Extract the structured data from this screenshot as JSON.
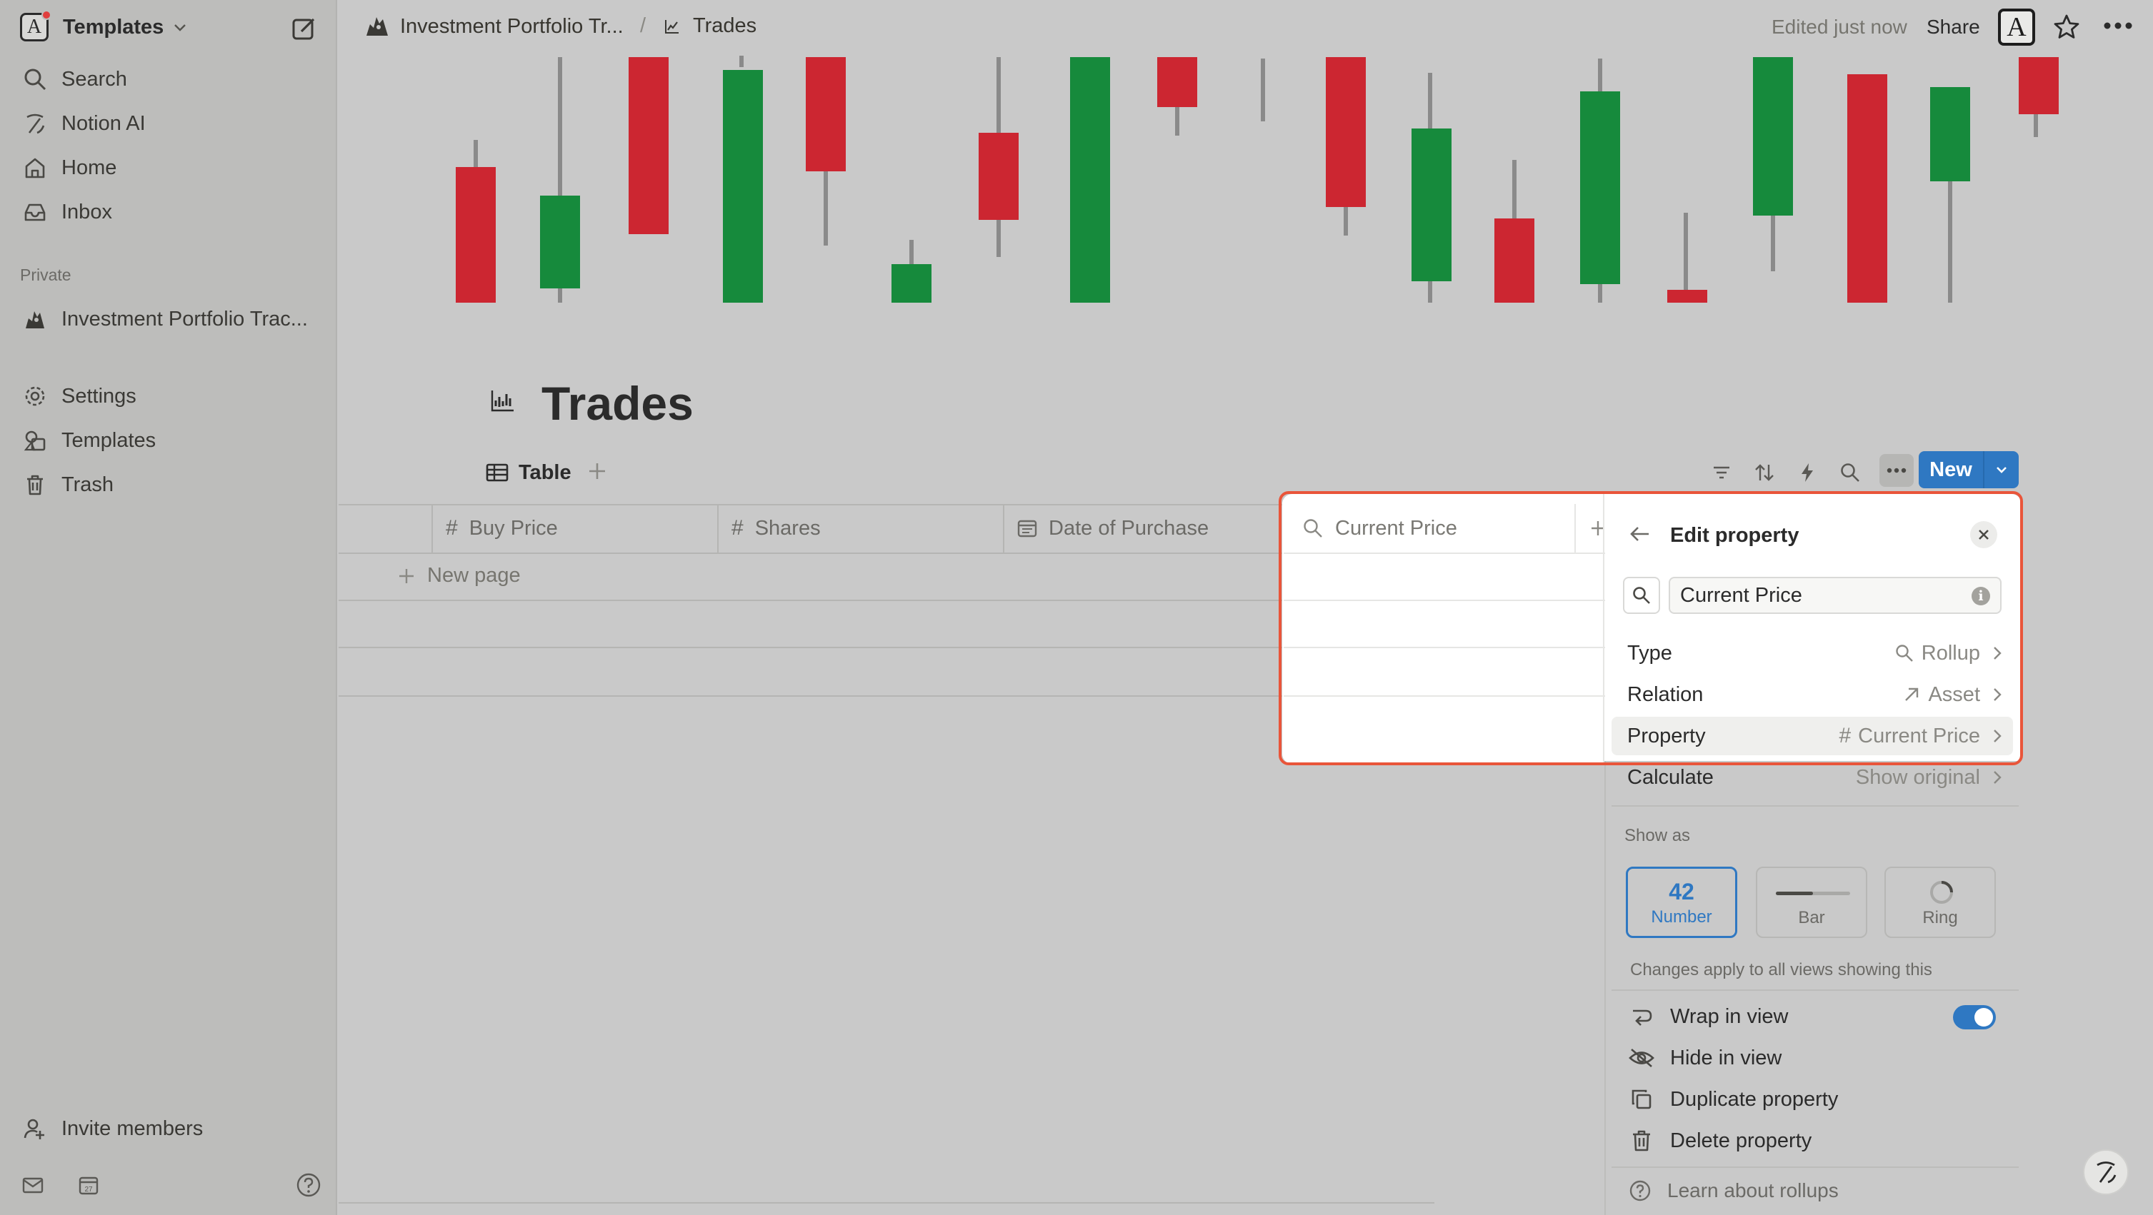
{
  "sidebar": {
    "workspace_name": "Templates",
    "items": [
      {
        "label": "Search",
        "icon": "search-icon"
      },
      {
        "label": "Notion AI",
        "icon": "notion-ai-icon"
      },
      {
        "label": "Home",
        "icon": "home-icon"
      },
      {
        "label": "Inbox",
        "icon": "inbox-icon"
      }
    ],
    "private_label": "Private",
    "private_pages": [
      {
        "label": "Investment Portfolio Trac...",
        "icon": "portfolio-icon"
      }
    ],
    "bottom_items": [
      {
        "label": "Settings",
        "icon": "gear-icon"
      },
      {
        "label": "Templates",
        "icon": "templates-icon"
      },
      {
        "label": "Trash",
        "icon": "trash-icon"
      }
    ],
    "invite_label": "Invite members"
  },
  "topbar": {
    "breadcrumb": [
      "Investment Portfolio Tr...",
      "Trades"
    ],
    "separator": "/",
    "edited": "Edited just now",
    "share": "Share",
    "avatar_letter": "A"
  },
  "page": {
    "title": "Trades"
  },
  "view": {
    "tab_label": "Table",
    "new_button": "New"
  },
  "table": {
    "columns": [
      {
        "label": "Buy Price",
        "type_icon": "#"
      },
      {
        "label": "Shares",
        "type_icon": "#"
      },
      {
        "label": "Date of Purchase",
        "type_icon": "calendar-icon"
      }
    ],
    "highlighted_column": "Current Price",
    "new_page_label": "New page"
  },
  "edit_property": {
    "title": "Edit property",
    "name_value": "Current Price",
    "rows": [
      {
        "key": "Type",
        "value": "Rollup",
        "icon": "search-icon"
      },
      {
        "key": "Relation",
        "value": "Asset",
        "icon": "arrow-up-right-icon"
      },
      {
        "key": "Property",
        "value": "Current Price",
        "icon": "hash-icon"
      },
      {
        "key": "Calculate",
        "value": "Show original",
        "icon": ""
      }
    ],
    "show_as_label": "Show as",
    "show_as": [
      {
        "label": "Number",
        "preview": "42",
        "selected": true
      },
      {
        "label": "Bar",
        "preview": "",
        "selected": false
      },
      {
        "label": "Ring",
        "preview": "",
        "selected": false
      }
    ],
    "changes_note": "Changes apply to all views showing this",
    "actions": [
      {
        "label": "Wrap in view",
        "icon": "wrap-icon",
        "toggle": true
      },
      {
        "label": "Hide in view",
        "icon": "eye-off-icon"
      },
      {
        "label": "Duplicate property",
        "icon": "duplicate-icon"
      },
      {
        "label": "Delete property",
        "icon": "trash-icon"
      }
    ],
    "learn_label": "Learn about rollups"
  },
  "colors": {
    "accent": "#2f78c2",
    "highlight_outline": "#e9553a",
    "candle_up": "#168a3c",
    "candle_down": "#cc2631"
  }
}
